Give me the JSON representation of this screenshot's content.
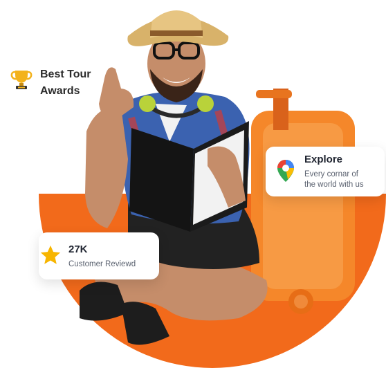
{
  "award": {
    "line1": "Best Tour",
    "line2": "Awards",
    "icon": "trophy-icon"
  },
  "explore": {
    "title": "Explore",
    "line1": "Every cornar of",
    "line2": "the world with us",
    "icon": "map-pin-icon"
  },
  "reviews": {
    "count": "27K",
    "label": "Customer Reviewd",
    "icon": "star-icon"
  },
  "colors": {
    "accent": "#f26a1b",
    "star": "#f7b500",
    "suitcase": "#f5872a"
  }
}
